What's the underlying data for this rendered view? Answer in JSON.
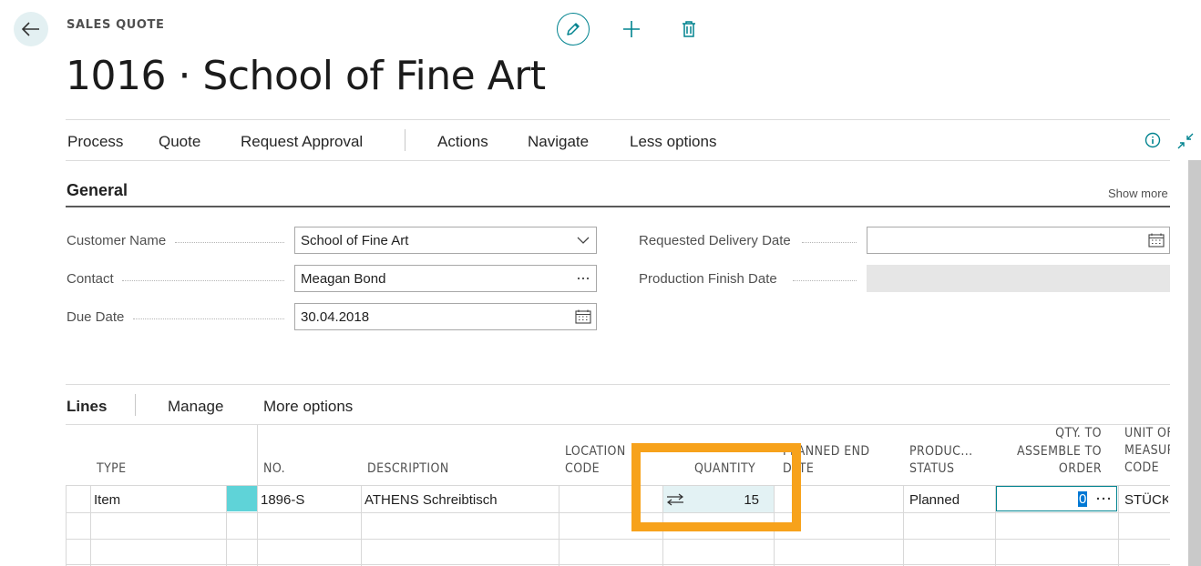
{
  "header": {
    "page_kind": "SALES QUOTE",
    "title": "1016 · School of Fine Art"
  },
  "actions": {
    "items": [
      "Process",
      "Quote",
      "Request Approval",
      "Actions",
      "Navigate",
      "Less options"
    ]
  },
  "general": {
    "title": "General",
    "show_more": "Show more",
    "fields": {
      "customer_name": {
        "label": "Customer Name",
        "value": "School of Fine Art"
      },
      "contact": {
        "label": "Contact",
        "value": "Meagan Bond"
      },
      "due_date": {
        "label": "Due Date",
        "value": "30.04.2018"
      },
      "requested_delivery_date": {
        "label": "Requested Delivery Date",
        "value": ""
      },
      "production_finish_date": {
        "label": "Production Finish Date",
        "value": ""
      }
    }
  },
  "lines": {
    "tabs": [
      "Lines",
      "Manage",
      "More options"
    ],
    "columns": {
      "type": "TYPE",
      "no": "NO.",
      "description": "DESCRIPTION",
      "location_1": "LOCATION",
      "location_2": "CODE",
      "quantity": "QUANTITY",
      "planned_1": "PLANNED END",
      "planned_2": "DATE",
      "prod_1": "PRODUC...",
      "prod_2": "STATUS",
      "qty_1": "QTY. TO",
      "qty_2": "ASSEMBLE TO",
      "qty_3": "ORDER",
      "uom_1": "UNIT OF",
      "uom_2": "MEASURE",
      "uom_3": "CODE"
    },
    "rows": [
      {
        "type": "Item",
        "no": "1896-S",
        "description": "ATHENS Schreibtisch",
        "location": "",
        "quantity": "15",
        "planned_end_date": "",
        "production_status": "Planned",
        "qty_to_assemble": "0",
        "uom": "STÜCK"
      }
    ]
  },
  "colors": {
    "accent": "#00838f",
    "highlight": "#f7a21b",
    "selected_cell": "#e3f2f4"
  }
}
